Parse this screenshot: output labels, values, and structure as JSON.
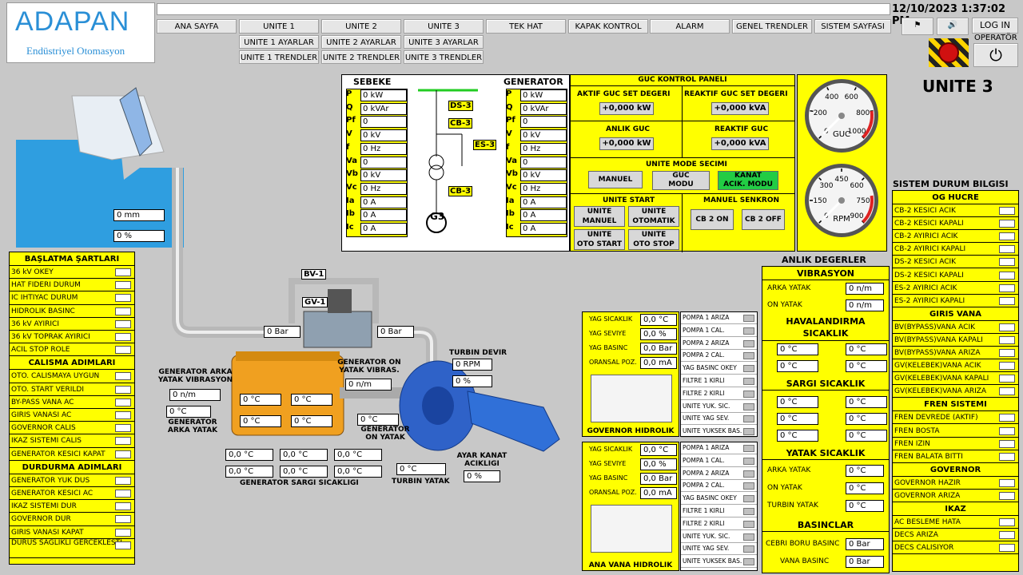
{
  "header": {
    "datetime": "12/10/2023 1:37:02 PM",
    "login": "LOG IN",
    "user": "OPERATÖR",
    "unit_title": "UNITE 3"
  },
  "logo": {
    "name": "ADAPAN",
    "sub": "Endüstriyel Otomasyon"
  },
  "nav": {
    "row1": [
      "ANA SAYFA",
      "UNITE 1",
      "UNITE 2",
      "UNITE 3",
      "TEK HAT",
      "KAPAK KONTROL",
      "ALARM",
      "GENEL TRENDLER",
      "SISTEM SAYFASI"
    ],
    "row2": [
      "UNITE 1 AYARLAR",
      "UNITE 2 AYARLAR",
      "UNITE 3 AYARLAR"
    ],
    "row3": [
      "UNITE 1 TRENDLER",
      "UNITE 2 TRENDLER",
      "UNITE 3 TRENDLER"
    ]
  },
  "sebeke": {
    "title": "SEBEKE",
    "labels": [
      "P",
      "Q",
      "Pf",
      "V",
      "f",
      "Va",
      "Vb",
      "Vc",
      "Ia",
      "Ib",
      "Ic"
    ],
    "values": [
      "0 kW",
      "0 kVAr",
      "0",
      "0 kV",
      "0 Hz",
      "0",
      "0 kV",
      "0 Hz",
      "0 A",
      "0 A",
      "0 A"
    ]
  },
  "generator": {
    "title": "GENERATOR",
    "labels": [
      "P",
      "Q",
      "Pf",
      "V",
      "f",
      "Va",
      "Vb",
      "Vc",
      "Ia",
      "Ib",
      "Ic"
    ],
    "values": [
      "0 kW",
      "0 kVAr",
      "0",
      "0 kV",
      "0 Hz",
      "0",
      "0 kV",
      "0 Hz",
      "0 A",
      "0 A",
      "0 A"
    ]
  },
  "single_line": {
    "ds": "DS-3",
    "cb1": "CB-3",
    "es": "ES-3",
    "cb2": "CB-3",
    "gen": "G3"
  },
  "guc": {
    "title": "GUC KONTROL PANELI",
    "aktif_set": "AKTIF GUC SET DEGERI",
    "aktif_set_val": "+0,000 kW",
    "reaktif_set": "REAKTIF GUC SET DEGERI",
    "reaktif_set_val": "+0,000 kVA",
    "anlik": "ANLIK GUC",
    "anlik_val": "+0,000 kW",
    "reaktif": "REAKTIF GUC",
    "reaktif_val": "+0,000 kVA",
    "mode_title": "UNITE MODE SECIMI",
    "mode1": "MANUEL",
    "mode2a": "GUC",
    "mode2b": "MODU",
    "mode3a": "KANAT",
    "mode3b": "ACIK. MODU",
    "start_title": "UNITE START",
    "sm1a": "UNITE",
    "sm1b": "MANUEL",
    "sm2a": "UNITE",
    "sm2b": "OTOMATIK",
    "sm3a": "UNITE",
    "sm3b": "OTO START",
    "sm4a": "UNITE",
    "sm4b": "OTO STOP",
    "senkron_title": "MANUEL SENKRON",
    "cb2on": "CB 2 ON",
    "cb2off": "CB 2 OFF"
  },
  "gauges": {
    "guc": {
      "label": "GUC",
      "ticks": [
        "0",
        "200",
        "400",
        "600",
        "800",
        "1000"
      ],
      "value": 0
    },
    "rpm": {
      "label": "RPM",
      "ticks": [
        "0",
        "150",
        "300",
        "450",
        "600",
        "750",
        "900"
      ],
      "value": 0
    }
  },
  "scada": {
    "tank_mm": "0 mm",
    "tank_pct": "0 %",
    "bv": "BV-1",
    "gv": "GV-1",
    "bar_left": "0 Bar",
    "bar_right": "0 Bar",
    "gen_arka_vib_label": "GENERATOR ARKA YATAK VIBRASYON",
    "gen_arka_vib": "0 n/m",
    "gen_arka_temp": "0 °C",
    "gen_arka_label": "GENERATOR ARKA YATAK",
    "gen_on_vib_label": "GENERATOR ON YATAK VIBRAS.",
    "gen_on_vib": "0 n/m",
    "gen_on_temp": "0 °C",
    "gen_on_label": "GENERATOR ON YATAK",
    "g_t1": "0 °C",
    "g_t2": "0 °C",
    "g_t3": "0 °C",
    "g_t4": "0 °C",
    "sargi": [
      "0,0 °C",
      "0,0 °C",
      "0,0 °C",
      "0,0 °C",
      "0,0 °C",
      "0,0 °C"
    ],
    "sargi_label": "GENERATOR SARGI SICAKLIGI",
    "turbin_devir_label": "TURBIN DEVIR",
    "turbin_rpm": "0 RPM",
    "turbin_pct": "0 %",
    "turbin_yatak": "0 °C",
    "turbin_yatak_label": "TURBIN YATAK",
    "ayar_label": "AYAR KANAT ACIKLIGI",
    "ayar_val": "0 %"
  },
  "baslatma": {
    "title": "BAŞLATMA ŞARTLARI",
    "items": [
      "36 kV OKEY",
      "HAT FIDERI DURUM",
      "IC IHTIYAC DURUM",
      "HIDROLIK BASINC",
      "36 kV AYIRICI",
      "36 kV TOPRAK AYIRICI",
      "ACIL STOP ROLE"
    ]
  },
  "calisma": {
    "title": "CALISMA ADIMLARI",
    "items": [
      "OTO. CALISMAYA UYGUN",
      "OTO. START VERILDI",
      "BY-PASS VANA AC",
      "GIRIS VANASI AC",
      "GOVERNOR CALIS",
      "IKAZ SISTEMI CALIS",
      "GENERATOR KESICI KAPAT"
    ]
  },
  "durdurma": {
    "title": "DURDURMA ADIMLARI",
    "items": [
      "GENERATOR YUK DUS",
      "GENERATOR KESICI AC",
      "IKAZ SISTEMI DUR",
      "GOVERNOR DUR",
      "GIRIS VANASI KAPAT",
      "DURUS SAGLIKLI GERCEKLESTI"
    ]
  },
  "hidrolik": [
    {
      "title": "GOVERNOR HIDROLIK",
      "vals": [
        [
          "YAG SICAKLIK",
          "0,0 °C"
        ],
        [
          "YAG SEVIYE",
          "0,0 %"
        ],
        [
          "YAG BASINC",
          "0,0 Bar"
        ],
        [
          "ORANSAL POZ.",
          "0,0 mA"
        ]
      ],
      "pumps": [
        "POMPA 1 ARIZA",
        "POMPA 1 CAL.",
        "POMPA 2 ARIZA",
        "POMPA 2 CAL.",
        "YAG BASINC OKEY",
        "FILTRE 1 KIRLI",
        "FILTRE 2 KIRLI",
        "UNITE YUK. SIC.",
        "UNITE YAG SEV.",
        "UNITE YUKSEK BAS."
      ]
    },
    {
      "title": "ANA VANA HIDROLIK",
      "vals": [
        [
          "YAG SICAKLIK",
          "0,0 °C"
        ],
        [
          "YAG SEVIYE",
          "0,0 %"
        ],
        [
          "YAG BASINC",
          "0,0 Bar"
        ],
        [
          "ORANSAL POZ.",
          "0,0 mA"
        ]
      ],
      "pumps": [
        "POMPA 1 ARIZA",
        "POMPA 1 CAL.",
        "POMPA 2 ARIZA",
        "POMPA 2 CAL.",
        "YAG BASINC OKEY",
        "FILTRE 1 KIRLI",
        "FILTRE 2 KIRLI",
        "UNITE YUK. SIC.",
        "UNITE YAG SEV.",
        "UNITE YUKSEK BAS."
      ]
    }
  ],
  "anlik": {
    "title": "ANLIK DEGERLER",
    "vib_title": "VIBRASYON",
    "arka": "ARKA YATAK",
    "arka_val": "0 n/m",
    "on": "ON YATAK",
    "on_val": "0 n/m",
    "hav_title": "HAVALANDIRMA SICAKLIK",
    "hav": [
      "0 °C",
      "0 °C",
      "0 °C",
      "0 °C"
    ],
    "sargi_title": "SARGI SICAKLIK",
    "sargi": [
      "0 °C",
      "0 °C",
      "0 °C",
      "0 °C",
      "0 °C",
      "0 °C"
    ],
    "yatak_title": "YATAK SICAKLIK",
    "y_arka": "ARKA YATAK",
    "y_arka_val": "0 °C",
    "y_on": "ON YATAK",
    "y_on_val": "0 °C",
    "y_turbin": "TURBIN YATAK",
    "y_turbin_val": "0 °C",
    "bas_title": "BASINCLAR",
    "cebri": "CEBRI BORU BASINC",
    "cebri_val": "0 Bar",
    "vana": "VANA BASINC",
    "vana_val": "0 Bar"
  },
  "sistem": {
    "title": "SISTEM DURUM BILGISI",
    "og_title": "OG HUCRE",
    "og": [
      "CB-2 KESICI ACIK",
      "CB-2 KESICI KAPALI",
      "CB-2 AYIRICI ACIK",
      "CB-2 AYIRICI KAPALI",
      "DS-2 KESICI ACIK",
      "DS-2 KESICI KAPALI",
      "ES-2 AYIRICI ACIK",
      "ES-2 AYIRICI KAPALI"
    ],
    "giris_title": "GIRIS VANA",
    "giris": [
      "BV(BYPASS)VANA ACIK",
      "BV(BYPASS)VANA KAPALI",
      "BV(BYPASS)VANA ARIZA",
      "GV(KELEBEK)VANA ACIK",
      "GV(KELEBEK)VANA KAPALI",
      "GV(KELEBEK)VANA ARIZA"
    ],
    "fren_title": "FREN SISTEMI",
    "fren": [
      "FREN DEVREDE (AKTIF)",
      "FREN BOSTA",
      "FREN IZIN",
      "FREN BALATA BITTI"
    ],
    "gov_title": "GOVERNOR",
    "gov": [
      "GOVERNOR HAZIR",
      "GOVERNOR ARIZA"
    ],
    "ikaz_title": "IKAZ",
    "ikaz": [
      "AC BESLEME HATA",
      "DECS ARIZA",
      "DECS CALISIYOR"
    ]
  },
  "colors": {
    "panel": "#ffff00",
    "bg": "#c8c8c8",
    "mode_active": "#22cc44"
  }
}
